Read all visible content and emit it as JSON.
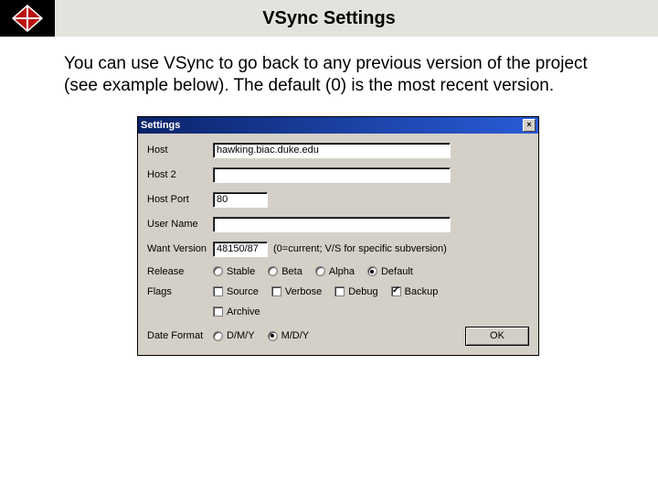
{
  "banner": {
    "title": "VSync Settings"
  },
  "description": "You can use VSync to go back to any previous version of the project (see example below). The default (0) is the most recent version.",
  "dialog": {
    "title": "Settings",
    "fields": {
      "host": {
        "label": "Host",
        "value": "hawking.biac.duke.edu"
      },
      "host2": {
        "label": "Host 2",
        "value": ""
      },
      "host_port": {
        "label": "Host Port",
        "value": "80"
      },
      "user_name": {
        "label": "User Name",
        "value": ""
      },
      "want_version": {
        "label": "Want Version",
        "value": "48150/87",
        "hint": "(0=current; V/S for specific subversion)"
      },
      "release": {
        "label": "Release"
      },
      "flags": {
        "label": "Flags"
      },
      "date_format": {
        "label": "Date Format"
      }
    },
    "release_options": {
      "stable": "Stable",
      "beta": "Beta",
      "alpha": "Alpha",
      "default": "Default",
      "selected": "default"
    },
    "flag_options": {
      "source": "Source",
      "verbose": "Verbose",
      "debug": "Debug",
      "backup": "Backup",
      "archive": "Archive"
    },
    "date_options": {
      "dmy": "D/M/Y",
      "mdy": "M/D/Y",
      "selected": "mdy"
    },
    "ok": "OK"
  }
}
